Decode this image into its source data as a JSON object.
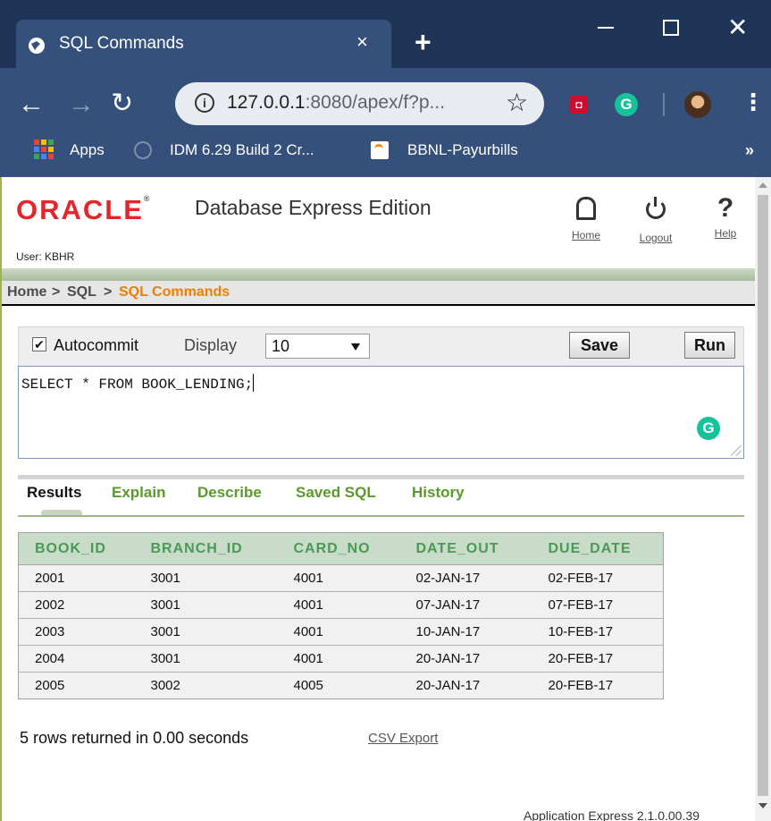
{
  "browser": {
    "tab_title": "SQL Commands",
    "tab_close": "×",
    "new_tab": "+",
    "url_host": "127.0.0.1",
    "url_rest": ":8080/apex/f?p...",
    "bookmarks": [
      "Apps",
      "IDM 6.29 Build 2 Cr...",
      "BBNL-Payurbills"
    ],
    "bookmarks_more": "»"
  },
  "header": {
    "logo": "ORACLE",
    "logo_mark": "®",
    "product": "Database Express Edition",
    "links": {
      "home": "Home",
      "logout": "Logout",
      "help": "Help"
    },
    "user": "User: KBHR"
  },
  "breadcrumb": {
    "items": [
      "Home",
      "SQL",
      "SQL Commands"
    ],
    "separator": ">"
  },
  "sql": {
    "autocommit_label": "Autocommit",
    "autocommit_checked": true,
    "display_label": "Display",
    "display_value": "10",
    "save_label": "Save",
    "run_label": "Run",
    "query": "SELECT * FROM BOOK_LENDING;"
  },
  "result_tabs": [
    "Results",
    "Explain",
    "Describe",
    "Saved SQL",
    "History"
  ],
  "results": {
    "columns": [
      "BOOK_ID",
      "BRANCH_ID",
      "CARD_NO",
      "DATE_OUT",
      "DUE_DATE"
    ],
    "rows": [
      [
        "2001",
        "3001",
        "4001",
        "02-JAN-17",
        "02-FEB-17"
      ],
      [
        "2002",
        "3001",
        "4001",
        "07-JAN-17",
        "07-FEB-17"
      ],
      [
        "2003",
        "3001",
        "4001",
        "10-JAN-17",
        "10-FEB-17"
      ],
      [
        "2004",
        "3001",
        "4001",
        "20-JAN-17",
        "20-FEB-17"
      ],
      [
        "2005",
        "3002",
        "4005",
        "20-JAN-17",
        "20-FEB-17"
      ]
    ],
    "summary": "5 rows returned in 0.00 seconds",
    "export_label": "CSV Export"
  },
  "footer": "Application Express 2.1.0.00.39",
  "colors": {
    "oracle_red": "#e3262b",
    "crumb_current": "#f07f00",
    "tab_green": "#5a9a2a",
    "header_green": "#4a9a56",
    "chrome_bg": "#1f3557"
  }
}
